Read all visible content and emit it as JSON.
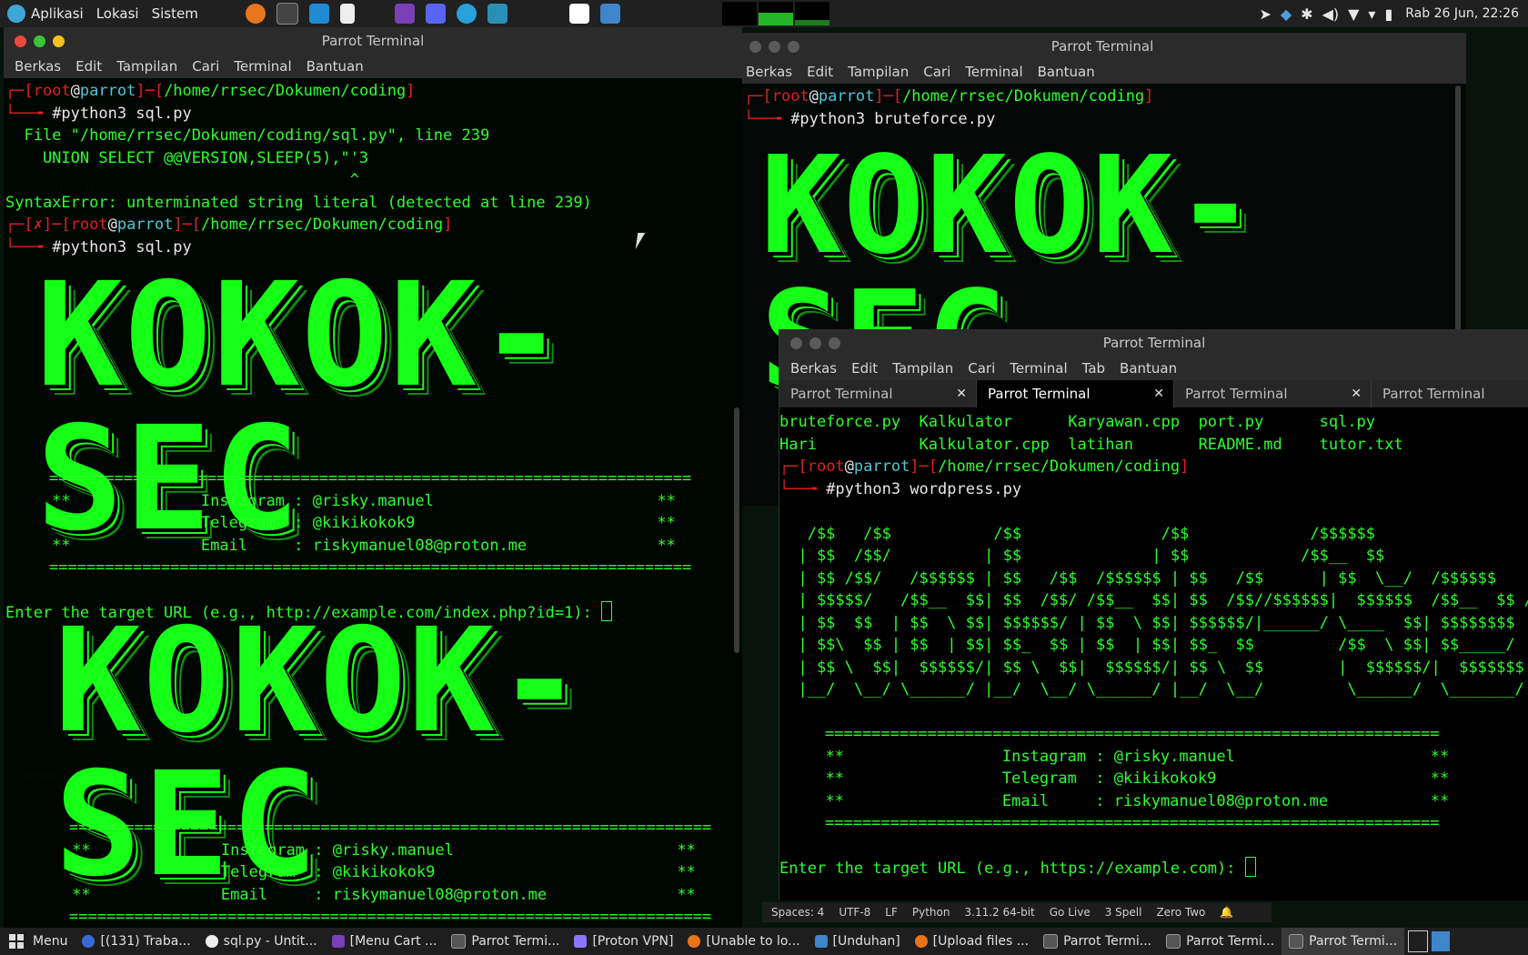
{
  "top_panel": {
    "menus": [
      "Aplikasi",
      "Lokasi",
      "Sistem"
    ],
    "clock": "Rab 26 Jun, 22:26"
  },
  "window_left": {
    "title": "Parrot Terminal",
    "menu": [
      "Berkas",
      "Edit",
      "Tampilan",
      "Cari",
      "Terminal",
      "Bantuan"
    ],
    "prompt_user": "root",
    "prompt_host": "parrot",
    "prompt_path": "/home/rrsec/Dokumen/coding",
    "cmd1": "#python3 sql.py",
    "err_line1": "  File \"/home/rrsec/Dokumen/coding/sql.py\", line 239",
    "err_line2": "    UNION SELECT @@VERSION,SLEEP(5),\"'3",
    "err_line3": "                                     ^",
    "err_line4": "SyntaxError: unterminated string literal (detected at line 239)",
    "fail_mark": "✗",
    "cmd2": "#python3 sql.py",
    "banner": "KOKOK-SEC",
    "rule": "=====================================================================",
    "insta": "     **              Instagram : @risky.manuel                        **",
    "tele": "     **              Telegram  : @kikikokok9                          **",
    "email": "     **              Email     : riskymanuel08@proton.me              **",
    "url_prompt": "Enter the target URL (e.g., http://example.com/index.php?id=1): "
  },
  "window_right_top": {
    "title": "Parrot Terminal",
    "menu": [
      "Berkas",
      "Edit",
      "Tampilan",
      "Cari",
      "Terminal",
      "Bantuan"
    ],
    "prompt_user": "root",
    "prompt_host": "parrot",
    "prompt_path": "/home/rrsec/Dokumen/coding",
    "cmd": "#python3 bruteforce.py",
    "banner": "KOKOK-SEC"
  },
  "window_right_bottom": {
    "title": "Parrot Terminal",
    "menu": [
      "Berkas",
      "Edit",
      "Tampilan",
      "Cari",
      "Terminal",
      "Tab",
      "Bantuan"
    ],
    "tabs": [
      "Parrot Terminal",
      "Parrot Terminal",
      "Parrot Terminal",
      "Parrot Terminal"
    ],
    "ls_row1": "bruteforce.py  Kalkulator      Karyawan.cpp  port.py      sql.py",
    "ls_row2": "Hari           Kalkulator.cpp  latihan       README.md    tutor.txt",
    "prompt_user": "root",
    "prompt_host": "parrot",
    "prompt_path": "/home/rrsec/Dokumen/coding",
    "cmd": "#python3 wordpress.py",
    "ascii": [
      "   /$$   /$$           /$$               /$$             /$$$$$$",
      "  | $$  /$$/          | $$              | $$            /$$__  $$",
      "  | $$ /$$/   /$$$$$$ | $$   /$$  /$$$$$$ | $$   /$$      | $$  \\__/  /$$$$$$",
      "  | $$$$$/   /$$__  $$| $$  /$$/ /$$__  $$| $$  /$$//$$$$$$|  $$$$$$  /$$__  $$ /",
      "  | $$  $$  | $$  \\ $$| $$$$$$/ | $$  \\ $$| $$$$$$/|______/ \\____  $$| $$$$$$$$",
      "  | $$\\  $$ | $$  | $$| $$_  $$ | $$  | $$| $$_  $$         /$$  \\ $$| $$_____/",
      "  | $$ \\  $$|  $$$$$$/| $$ \\  $$|  $$$$$$/| $$ \\  $$        |  $$$$$$/|  $$$$$$$",
      "  |__/  \\__/ \\______/ |__/  \\__/ \\______/ |__/  \\__/         \\______/  \\_______/"
    ],
    "rule": "==================================================================",
    "insta": "  **                 Instagram : @risky.manuel                     **",
    "tele": "  **                 Telegram  : @kikikokok9                       **",
    "email": "  **                 Email     : riskymanuel08@proton.me           **",
    "url_prompt": "Enter the target URL (e.g., https://example.com): "
  },
  "editor_status": [
    "Spaces: 4",
    "UTF-8",
    "LF",
    "Python",
    "3.11.2 64-bit",
    "Go Live",
    "3 Spell",
    "Zero Two"
  ],
  "taskbar": {
    "menu_label": "Menu",
    "tasks": [
      "[(131) Traba...",
      "sql.py - Untit...",
      "[Menu Cart ...",
      "Parrot Termi...",
      "[Proton VPN]",
      "[Unable to lo...",
      "[Unduhan]",
      "[Upload files ...",
      "Parrot Termi...",
      "Parrot Termi...",
      "Parrot Termi..."
    ]
  },
  "colors": {
    "terminal_green": "#2bff2b",
    "prompt_red": "#e02020",
    "host_cyan": "#4ec7d6"
  }
}
